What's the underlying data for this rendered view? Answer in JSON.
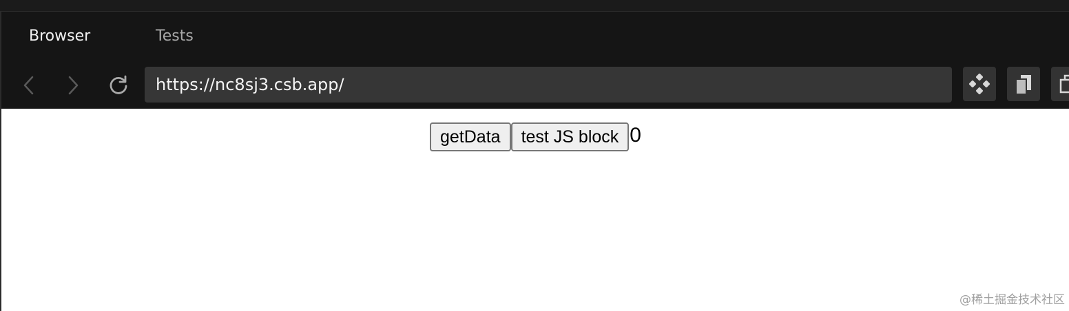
{
  "tabs": [
    {
      "label": "Browser",
      "active": true
    },
    {
      "label": "Tests",
      "active": false
    }
  ],
  "toolbar": {
    "back_icon": "chevron-left-icon",
    "forward_icon": "chevron-right-icon",
    "reload_icon": "reload-icon",
    "url": "https://nc8sj3.csb.app/",
    "tools": [
      "devtools-icon",
      "copy-icon",
      "window-icon"
    ]
  },
  "page": {
    "buttons": [
      "getData",
      "test JS block"
    ],
    "counter": "0"
  },
  "watermark": "@稀土掘金技术社区",
  "colors": {
    "chrome_bg": "#151515",
    "url_bg": "#363636",
    "tool_btn_bg": "#333333",
    "text_active": "#f2f2f2",
    "text_inactive": "#a8a8a8"
  }
}
